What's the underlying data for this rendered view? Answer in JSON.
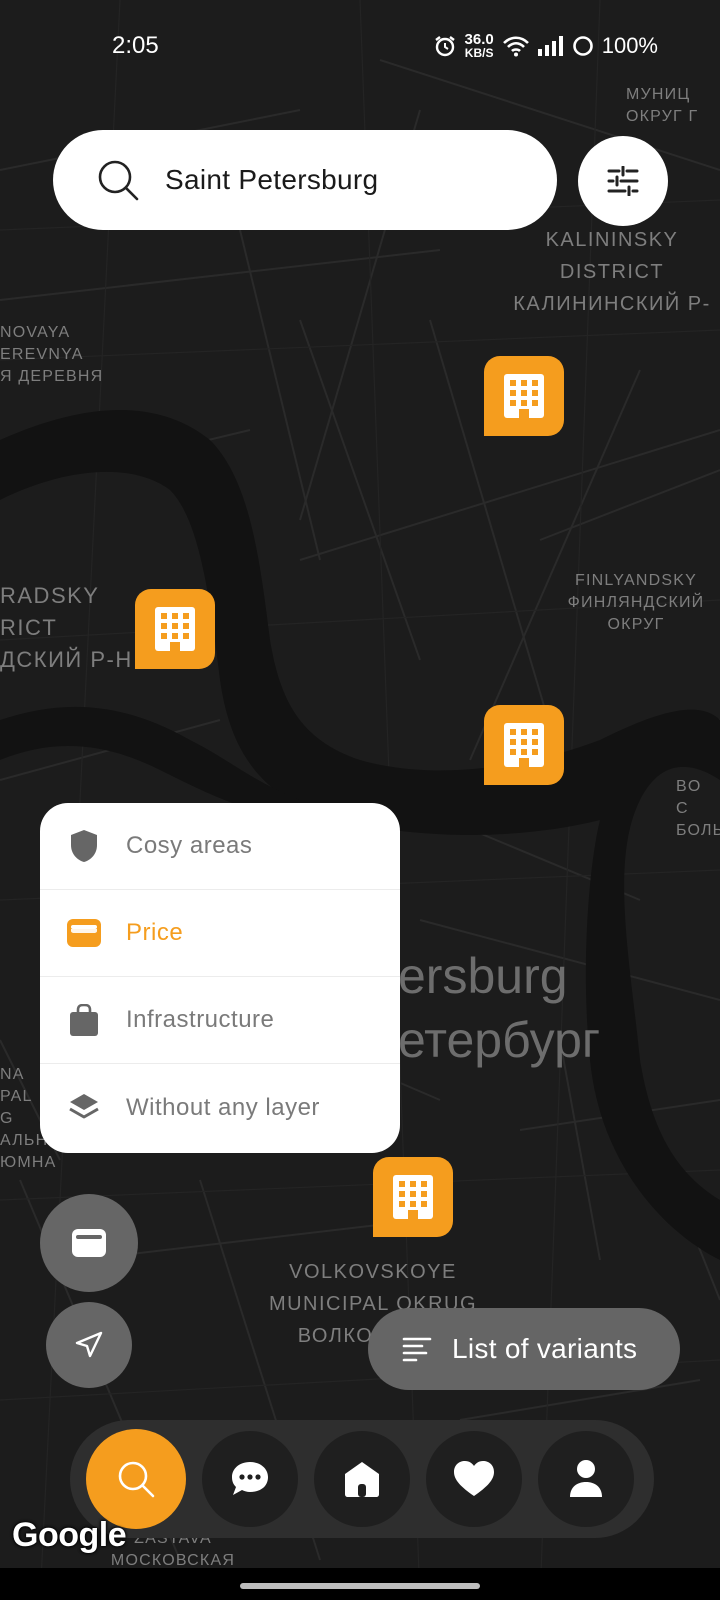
{
  "status_bar": {
    "time": "2:05",
    "network_speed_value": "36.0",
    "network_speed_unit": "KB/S",
    "battery": "100%"
  },
  "map": {
    "labels": {
      "municipal_1": "МУНИЦ",
      "municipal_2": "ОКРУГ Г",
      "kalininsky_1": "KALININSKY",
      "kalininsky_2": "DISTRICT",
      "kalininsky_3": "КАЛИНИНСКИЙ Р-",
      "novaya_1": "NOVAYA",
      "novaya_2": "EREVNYA",
      "novaya_3": "Я ДЕРЕВНЯ",
      "radsky_1": "RADSKY",
      "radsky_2": "RICT",
      "radsky_3": "ДСКИЙ Р-Н",
      "finlyandsky_1": "FINLYANDSKY",
      "finlyandsky_2": "ФИНЛЯНДСКИЙ",
      "finlyandsky_3": "ОКРУГ",
      "bo_1": "BO",
      "bo_2": "C",
      "bo_3": "БОЛЬ",
      "city_en": "ersburg",
      "city_ru": "етербург",
      "left_1": "NA",
      "left_2": "PAL",
      "left_3": "G",
      "left_4": "АЛЬНЫ",
      "left_5": "ЮМНА",
      "volkovskoye_1": "VOLKOVSKOYE",
      "volkovskoye_2": "MUNICIPAL OKRUG",
      "volkovskoye_3": "ВОЛКОВСКОЕ",
      "zastava_1": "ZASTAVA",
      "zastava_2": "МОСКОВСКАЯ"
    },
    "attribution": "Google"
  },
  "search": {
    "value": "Saint Petersburg",
    "icon": "search-icon"
  },
  "filter_button": {
    "icon": "sliders-icon"
  },
  "layers": {
    "accent_color": "#f59d1e",
    "items": [
      {
        "label": "Cosy areas",
        "icon": "shield-icon",
        "active": false
      },
      {
        "label": "Price",
        "icon": "wallet-icon",
        "active": true
      },
      {
        "label": "Infrastructure",
        "icon": "shopping-bag-icon",
        "active": false
      },
      {
        "label": "Without any layer",
        "icon": "layers-icon",
        "active": false
      }
    ]
  },
  "list_button": {
    "label": "List of variants",
    "icon": "list-icon"
  },
  "bottom_nav": {
    "items": [
      {
        "icon": "search-icon",
        "active": true
      },
      {
        "icon": "chat-icon",
        "active": false
      },
      {
        "icon": "home-icon",
        "active": false
      },
      {
        "icon": "heart-icon",
        "active": false
      },
      {
        "icon": "profile-icon",
        "active": false
      }
    ]
  }
}
